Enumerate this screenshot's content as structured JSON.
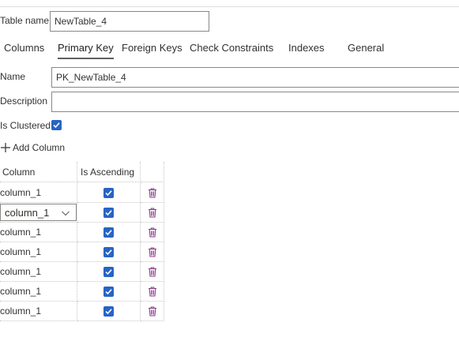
{
  "table_name_label": "Table name",
  "table_name_value": "NewTable_4",
  "tabs": [
    {
      "label": "Columns",
      "active": false
    },
    {
      "label": "Primary Key",
      "active": true
    },
    {
      "label": "Foreign Keys",
      "active": false
    },
    {
      "label": "Check Constraints",
      "active": false
    },
    {
      "label": "Indexes",
      "active": false
    },
    {
      "label": "General",
      "active": false
    }
  ],
  "name_label": "Name",
  "name_value": "PK_NewTable_4",
  "description_label": "Description",
  "description_value": "",
  "is_clustered_label": "Is Clustered",
  "is_clustered_checked": true,
  "add_column_label": "Add Column",
  "grid_headers": {
    "column": "Column",
    "is_ascending": "Is Ascending"
  },
  "grid_rows": [
    {
      "column": "column_1",
      "is_ascending": true,
      "editing": false
    },
    {
      "column": "column_1",
      "is_ascending": true,
      "editing": true
    },
    {
      "column": "column_1",
      "is_ascending": true,
      "editing": false
    },
    {
      "column": "column_1",
      "is_ascending": true,
      "editing": false
    },
    {
      "column": "column_1",
      "is_ascending": true,
      "editing": false
    },
    {
      "column": "column_1",
      "is_ascending": true,
      "editing": false
    },
    {
      "column": "column_1",
      "is_ascending": true,
      "editing": false
    }
  ],
  "icons": {
    "add": "plus-icon",
    "delete": "trash-icon",
    "dropdown": "chevron-down-icon",
    "check": "checkmark-icon"
  },
  "colors": {
    "checkbox": "#2764c4",
    "trash": "#8b3d8a",
    "border": "#8a8886",
    "grid_line": "#c8c6c4"
  }
}
